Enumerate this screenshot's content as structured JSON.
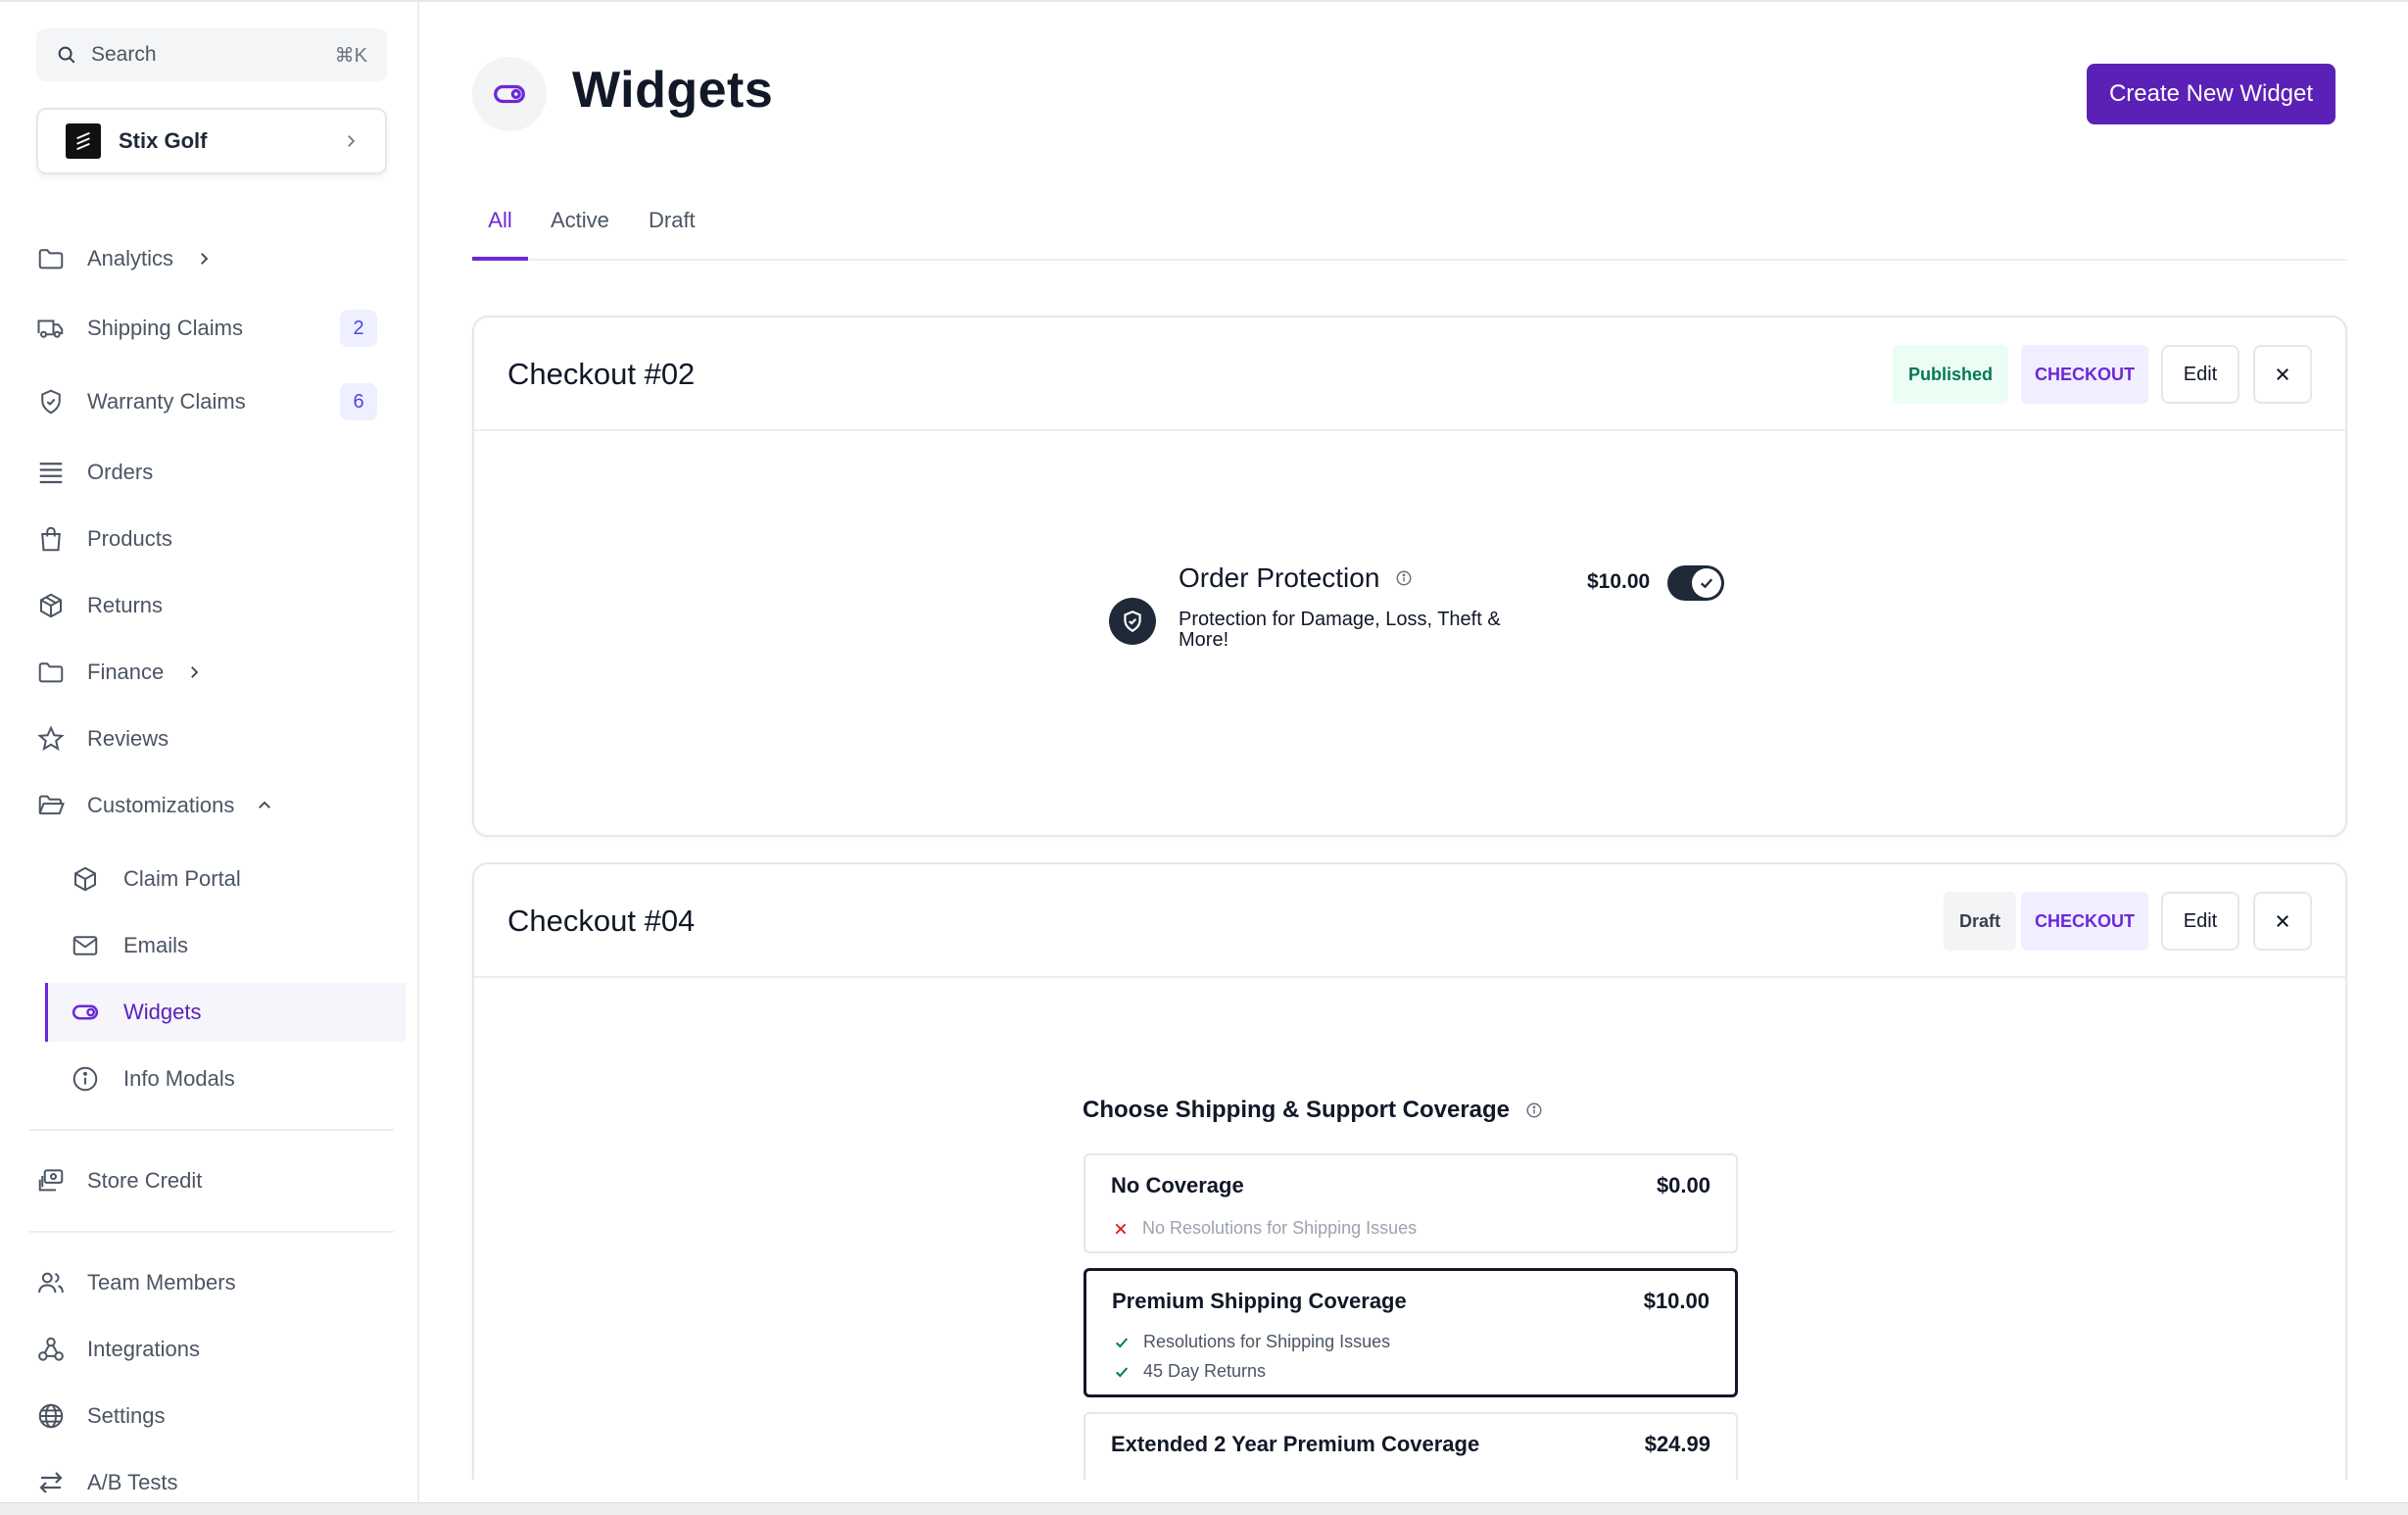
{
  "sidebar": {
    "search": {
      "label": "Search",
      "shortcut": "⌘K"
    },
    "store": {
      "name": "Stix Golf"
    },
    "nav": {
      "analytics": "Analytics",
      "shipping_claims": "Shipping Claims",
      "shipping_claims_count": "2",
      "warranty_claims": "Warranty Claims",
      "warranty_claims_count": "6",
      "orders": "Orders",
      "products": "Products",
      "returns": "Returns",
      "finance": "Finance",
      "reviews": "Reviews",
      "customizations": "Customizations",
      "claim_portal": "Claim Portal",
      "emails": "Emails",
      "widgets": "Widgets",
      "info_modals": "Info Modals",
      "store_credit": "Store Credit",
      "team_members": "Team Members",
      "integrations": "Integrations",
      "settings": "Settings",
      "ab_tests": "A/B Tests"
    }
  },
  "header": {
    "title": "Widgets",
    "create_label": "Create New Widget"
  },
  "tabs": [
    "All",
    "Active",
    "Draft"
  ],
  "widgets": [
    {
      "title": "Checkout #02",
      "status": "Published",
      "type": "CHECKOUT",
      "edit_label": "Edit",
      "preview": {
        "title": "Order Protection",
        "description": "Protection for Damage, Loss, Theft & More!",
        "price": "$10.00"
      }
    },
    {
      "title": "Checkout #04",
      "status": "Draft",
      "type": "CHECKOUT",
      "edit_label": "Edit",
      "preview": {
        "heading": "Choose Shipping & Support Coverage",
        "options": [
          {
            "title": "No Coverage",
            "price": "$0.00",
            "features": [
              "No Resolutions for Shipping Issues"
            ]
          },
          {
            "title": "Premium Shipping Coverage",
            "price": "$10.00",
            "features": [
              "Resolutions for Shipping Issues",
              "45 Day Returns"
            ]
          },
          {
            "title": "Extended 2 Year Premium Coverage",
            "price": "$24.99",
            "features": []
          }
        ]
      }
    }
  ],
  "colors": {
    "accent": "#6d28d9",
    "primary_button": "#5b21b6",
    "published_text": "#047857",
    "published_bg": "#ecfdf3",
    "negative_x": "#dc2626",
    "positive_check": "#047857"
  }
}
